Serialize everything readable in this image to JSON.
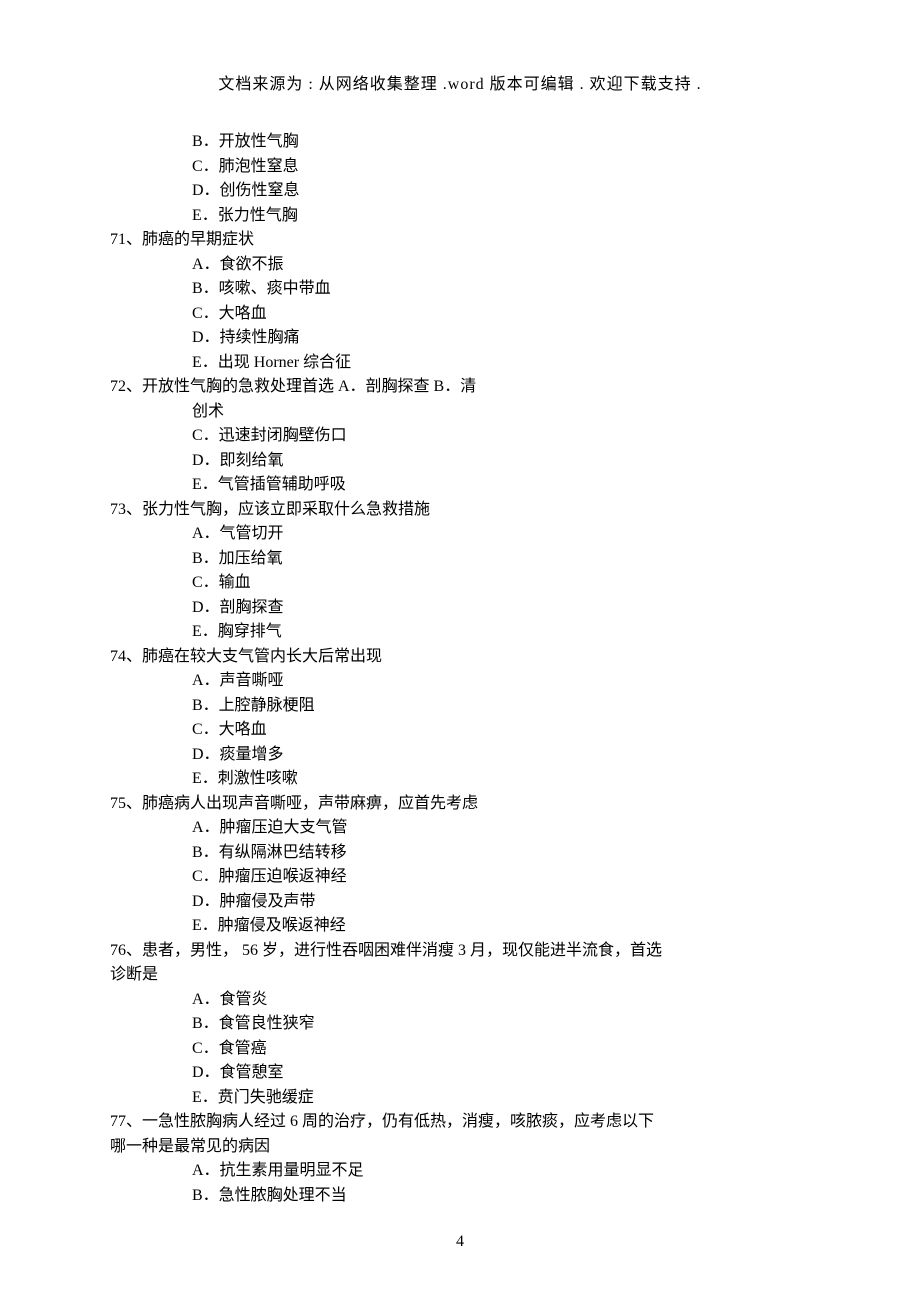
{
  "header": "文档来源为 : 从网络收集整理 .word 版本可编辑 . 欢迎下载支持 .",
  "page_number": "4",
  "pre_options": [
    "B．开放性气胸",
    "C．肺泡性窒息",
    "D．创伤性窒息",
    "E．张力性气胸"
  ],
  "questions": [
    {
      "stem": "71、肺癌的早期症状",
      "stem_cont": "",
      "options": [
        "A．食欲不振",
        "B．咳嗽、痰中带血",
        "C．大咯血",
        "D．持续性胸痛",
        "E．出现 Horner 综合征"
      ]
    },
    {
      "stem": "72、开放性气胸的急救处理首选 A．剖胸探查 B．清",
      "stem_cont": "创术",
      "options": [
        "",
        "C．迅速封闭胸壁伤口",
        "D．即刻给氧",
        "E．气管插管辅助呼吸"
      ]
    },
    {
      "stem": "73、张力性气胸，应该立即采取什么急救措施",
      "stem_cont": "",
      "options": [
        "A．气管切开",
        "B．加压给氧",
        "C．输血",
        "D．剖胸探查",
        "E．胸穿排气"
      ]
    },
    {
      "stem": "74、肺癌在较大支气管内长大后常出现",
      "stem_cont": "",
      "options": [
        "A．声音嘶哑",
        "B．上腔静脉梗阻",
        "C．大咯血",
        "D．痰量增多",
        "E．刺激性咳嗽"
      ]
    },
    {
      "stem": "75、肺癌病人出现声音嘶哑，声带麻痹，应首先考虑",
      "stem_cont": "",
      "options": [
        "A．肿瘤压迫大支气管",
        "B．有纵隔淋巴结转移",
        "C．肿瘤压迫喉返神经",
        "D．肿瘤侵及声带",
        "E．肿瘤侵及喉返神经"
      ]
    },
    {
      "stem": "76、患者，男性， 56 岁，进行性吞咽困难伴消瘦 3 月，现仅能进半流食，首选",
      "stem_no_indent": true,
      "stem_line2": "诊断是",
      "options": [
        "A．食管炎",
        "B．食管良性狭窄",
        "C．食管癌",
        "D．食管憩室",
        "E．贲门失驰缓症"
      ]
    },
    {
      "stem": "77、一急性脓胸病人经过 6 周的治疗，仍有低热，消瘦，咳脓痰，应考虑以下",
      "stem_no_indent": true,
      "stem_line2": "哪一种是最常见的病因",
      "options": [
        "A．抗生素用量明显不足",
        "B．急性脓胸处理不当"
      ]
    }
  ]
}
